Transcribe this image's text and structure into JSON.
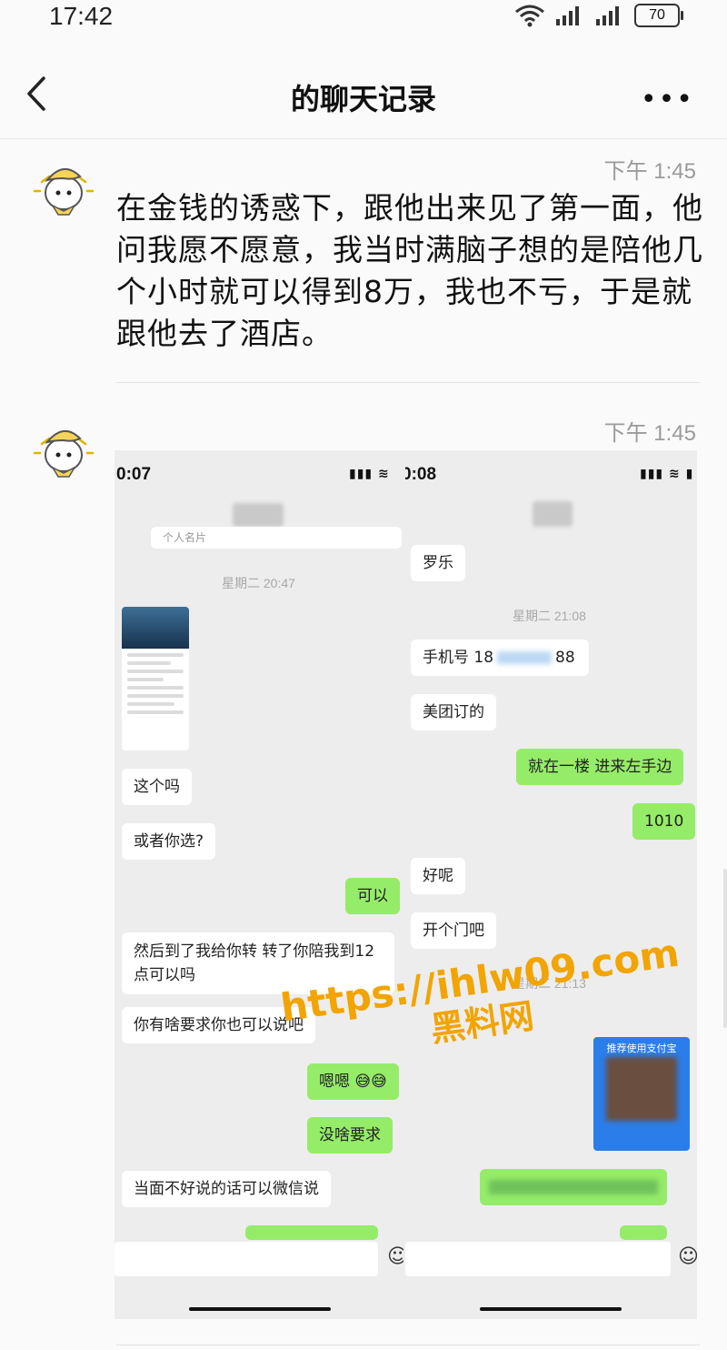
{
  "status_bar": {
    "time": "17:42",
    "battery": "70"
  },
  "nav": {
    "title": "的聊天记录"
  },
  "messages": [
    {
      "time": "下午 1:45",
      "text": "在金钱的诱惑下，跟他出来见了第一面，他问我愿不愿意，我当时满脑子想的是陪他几个小时就可以得到8万，我也不亏，于是就跟他去了酒店。"
    },
    {
      "time": "下午 1:45"
    }
  ],
  "screenshot": {
    "left": {
      "status_time": "0:07",
      "card_label": "个人名片",
      "time1": "星期二 20:47",
      "bubbles": [
        "这个吗",
        "或者你选?",
        "可以",
        "然后到了我给你转 转了你陪我到12点可以吗",
        "你有啥要求你也可以说吧",
        "嗯嗯",
        "没啥要求",
        "当面不好说的话可以微信说"
      ]
    },
    "right": {
      "status_time": "0:08",
      "bubbles": [
        "罗乐",
        "手机号 18",
        "88",
        "美团订的",
        "就在一楼 进来左手边",
        "1010",
        "好呢",
        "开个门吧"
      ],
      "time1": "星期二 21:08",
      "time2": "星期二 21:13",
      "pay_title": "推荐使用支付宝"
    }
  },
  "watermark": {
    "line1": "https://ihlw09.com",
    "line2": "黑料网"
  }
}
